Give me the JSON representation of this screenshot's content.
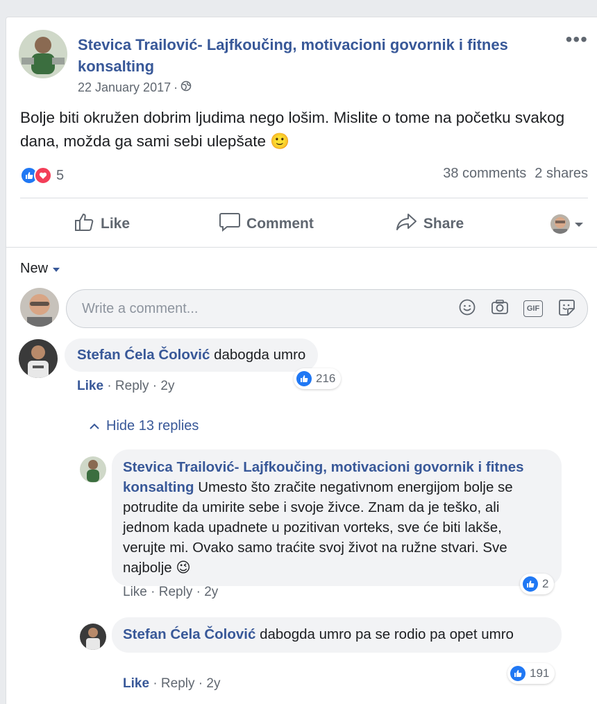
{
  "post": {
    "author": "Stevica Trailović- Lajfkoučing, motivacioni govornik i fitnes konsalting",
    "date": "22 January 2017",
    "separator": "·",
    "more_label": "•••",
    "text": "Bolje biti okružen dobrim ljudima nego lošim. Mislite o tome na početku svakog dana, možda ga sami sebi ulepšate 🙂",
    "reaction_count": "5",
    "comments_count": "38 comments",
    "shares_count": "2 shares"
  },
  "actions": {
    "like": "Like",
    "comment": "Comment",
    "share": "Share"
  },
  "comments_section": {
    "filter": "New",
    "input_placeholder": "Write a comment...",
    "gif_label": "GIF"
  },
  "comments": [
    {
      "author": "Stefan Ćela Čolović",
      "text": "dabogda umro",
      "like": "Like",
      "reply": "Reply",
      "age": "2y",
      "reactions": "216"
    }
  ],
  "hide_replies": "Hide 13 replies",
  "replies": [
    {
      "author": "Stevica Trailović- Lajfkoučing, motivacioni govornik i fitnes konsalting",
      "text": "Umesto što zračite negativnom energijom bolje se potrudite da umirite sebe i svoje živce. Znam da je teško, ali jednom kada upadnete u pozitivan vorteks, sve će biti lakše, verujte mi. Ovako samo traćite svoj život na ružne stvari. Sve najbolje 😉",
      "like": "Like",
      "reply": "Reply",
      "age": "2y",
      "reactions": "2"
    },
    {
      "author": "Stefan Ćela Čolović",
      "text": "dabogda umro pa se rodio pa opet umro",
      "like": "Like",
      "reply": "Reply",
      "age": "2y",
      "reactions": "191"
    }
  ],
  "colors": {
    "link": "#385898",
    "like_blue": "#2078f4",
    "love_red": "#f33e58",
    "muted": "#606770"
  }
}
